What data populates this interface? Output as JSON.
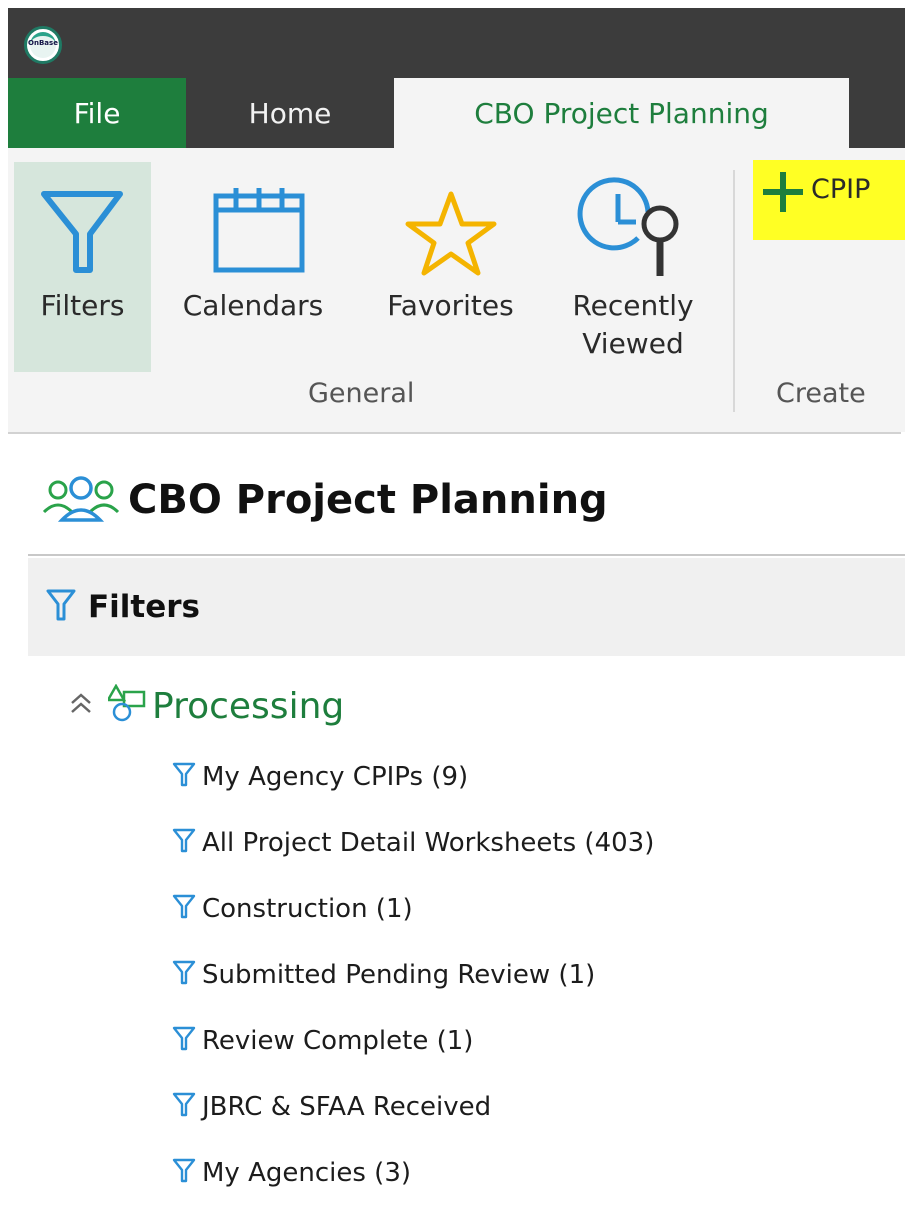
{
  "app": {
    "logo_text": "OnBase"
  },
  "tabs": [
    {
      "label": "File"
    },
    {
      "label": "Home"
    },
    {
      "label": "CBO Project Planning"
    }
  ],
  "ribbon": {
    "buttons": [
      {
        "label": "Filters",
        "icon": "filter-icon"
      },
      {
        "label": "Calendars",
        "icon": "calendar-icon"
      },
      {
        "label": "Favorites",
        "icon": "star-icon"
      },
      {
        "label_line1": "Recently",
        "label_line2": "Viewed",
        "icon": "clock-search-icon"
      }
    ],
    "groups": {
      "general": "General",
      "create": "Create"
    },
    "create_button": {
      "label": "CPIP",
      "icon": "plus-icon"
    }
  },
  "content": {
    "title": "CBO Project Planning",
    "filters_header": "Filters",
    "section": "Processing",
    "items": [
      "My Agency CPIPs (9)",
      "All Project Detail Worksheets (403)",
      "Construction (1)",
      "Submitted Pending Review (1)",
      "Review Complete (1)",
      "JBRC & SFAA Received",
      "My Agencies (3)"
    ]
  },
  "colors": {
    "accent_green": "#1e7e3d",
    "filter_blue": "#2b8fd6",
    "highlight_yellow": "#ffff24",
    "titlebar": "#3c3c3c"
  }
}
